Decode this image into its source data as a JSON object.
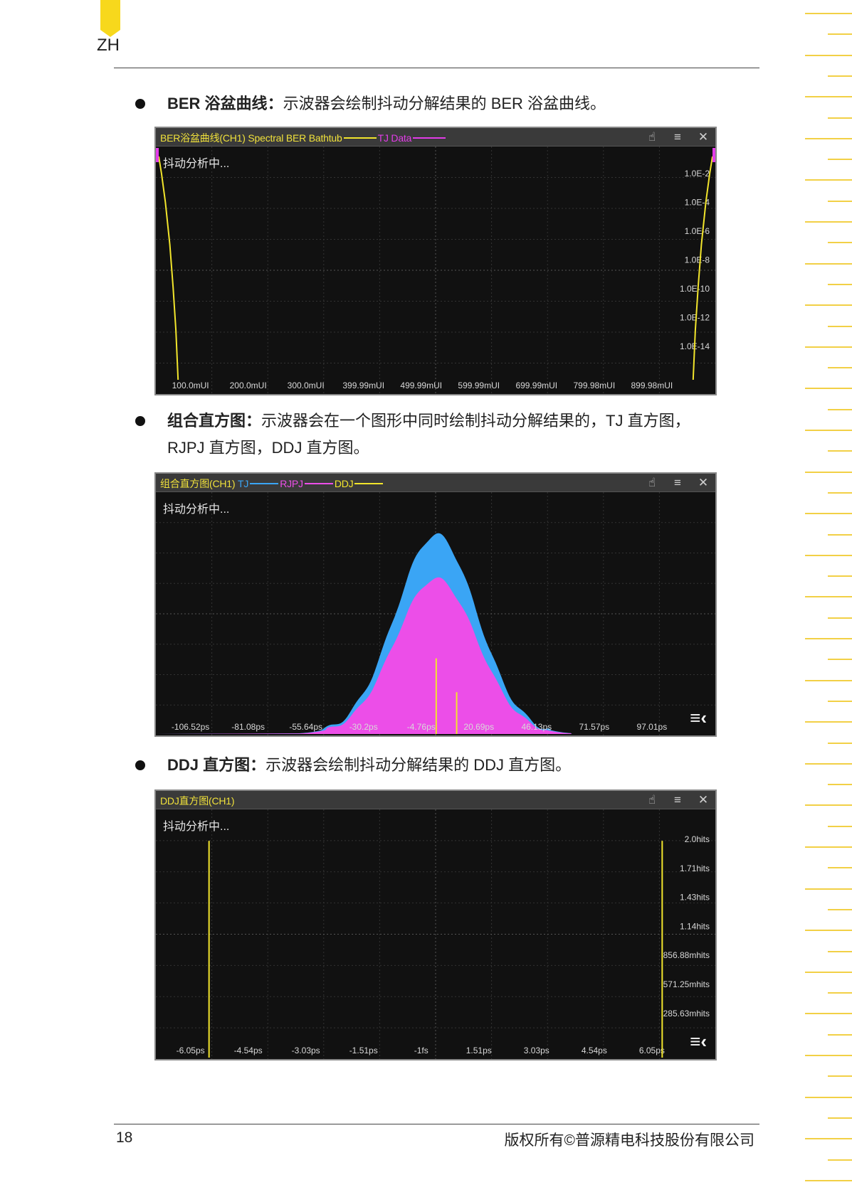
{
  "header": {
    "lang_code": "ZH"
  },
  "sections": [
    {
      "term": "BER 浴盆曲线",
      "sep": "：",
      "text": "示波器会绘制抖动分解结果的 BER 浴盆曲线。",
      "window": {
        "title": "BER浴盆曲线(CH1) Spectral BER Bathtub",
        "legend": [
          {
            "name": "",
            "color": "#f2e52c"
          },
          {
            "name": "TJ Data",
            "color": "#e33ce8"
          }
        ],
        "status": "抖动分析中...",
        "toolbar_icons": [
          "touch-icon",
          "menu-icon",
          "close-icon"
        ]
      }
    },
    {
      "term": "组合直方图",
      "sep": "：",
      "text_line1": "示波器会在一个图形中同时绘制抖动分解结果的，TJ 直方图，",
      "text_line2": "RJPJ 直方图，DDJ 直方图。",
      "window": {
        "title": "组合直方图(CH1)",
        "legend": [
          {
            "name": "TJ",
            "color": "#3aa5f5"
          },
          {
            "name": "RJPJ",
            "color": "#ec4ee8"
          },
          {
            "name": "DDJ",
            "color": "#f2e52c"
          }
        ],
        "status": "抖动分析中...",
        "toolbar_icons": [
          "touch-icon",
          "menu-icon",
          "close-icon"
        ]
      }
    },
    {
      "term": "DDJ 直方图",
      "sep": "：",
      "text": "示波器会绘制抖动分解结果的 DDJ 直方图。",
      "window": {
        "title": "DDJ直方图(CH1)",
        "status": "抖动分析中...",
        "toolbar_icons": [
          "touch-icon",
          "menu-icon",
          "close-icon"
        ]
      }
    }
  ],
  "chart_data": [
    {
      "type": "line",
      "x_unit": "mUI",
      "y_scale": "log",
      "x_ticks": [
        "100.0mUI",
        "200.0mUI",
        "300.0mUI",
        "399.99mUI",
        "499.99mUI",
        "599.99mUI",
        "699.99mUI",
        "799.98mUI",
        "899.98mUI"
      ],
      "y_ticks": [
        "1.0E-2",
        "1.0E-4",
        "1.0E-6",
        "1.0E-8",
        "1.0E-10",
        "1.0E-12",
        "1.0E-14"
      ],
      "xlim": [
        0,
        1000
      ],
      "series": [
        {
          "name": "",
          "color": "#f2e52c",
          "points": [
            [
              0,
              0.2
            ],
            [
              5,
              -1
            ],
            [
              12,
              -3
            ],
            [
              20,
              -6
            ],
            [
              26,
              -9
            ],
            [
              31,
              -12
            ],
            [
              35,
              -15.5
            ]
          ]
        },
        {
          "name": "",
          "color": "#f2e52c",
          "points": [
            [
              1000,
              0.2
            ],
            [
              995,
              -1
            ],
            [
              988,
              -3
            ],
            [
              980,
              -6
            ],
            [
              974,
              -9
            ],
            [
              969,
              -12
            ],
            [
              965,
              -15.5
            ]
          ]
        }
      ]
    },
    {
      "type": "area",
      "x_unit": "ps",
      "x_ticks": [
        "-106.52ps",
        "-81.08ps",
        "-55.64ps",
        "-30.2ps",
        "-4.76ps",
        "20.69ps",
        "46.13ps",
        "71.57ps",
        "97.01ps"
      ],
      "series": [
        {
          "name": "TJ",
          "color": "#3aa5f5",
          "center": -4.76,
          "sigma": 16.5,
          "peak": 1.0
        },
        {
          "name": "RJPJ",
          "color": "#ec4ee8",
          "center": -4.76,
          "sigma": 16.5,
          "peak": 0.78
        },
        {
          "name": "DDJ",
          "color": "#f2e52c",
          "spikes": [
            [
              -4.76,
              0.38
            ],
            [
              3.5,
              0.21
            ]
          ]
        }
      ]
    },
    {
      "type": "bar",
      "x_unit": "ps",
      "x_ticks": [
        "-6.05ps",
        "-4.54ps",
        "-3.03ps",
        "-1.51ps",
        "-1fs",
        "1.51ps",
        "3.03ps",
        "4.54ps",
        "6.05ps"
      ],
      "y_ticks": [
        "2.0hits",
        "1.71hits",
        "1.43hits",
        "1.14hits",
        "856.88mhits",
        "571.25mhits",
        "285.63mhits"
      ],
      "ylim": [
        0,
        2.29
      ],
      "xlim": [
        -7.56,
        7.56
      ],
      "bars": [
        {
          "x": -7.56,
          "value": 2.0
        },
        {
          "x": 7.56,
          "value": 2.0
        }
      ],
      "color": "#f2e52c"
    }
  ],
  "footer": {
    "page_number": "18",
    "copyright": "版权所有©普源精电科技股份有限公司"
  }
}
